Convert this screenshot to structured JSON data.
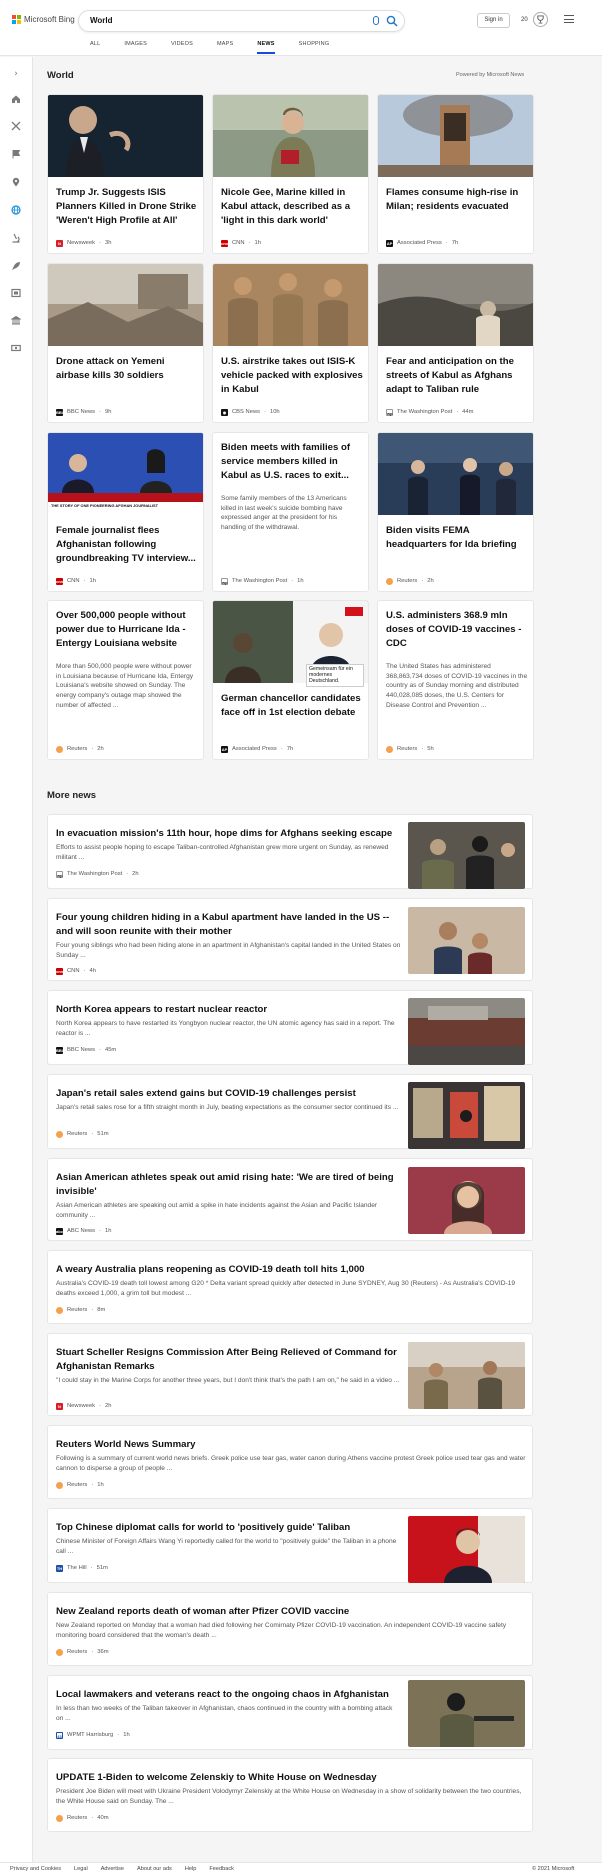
{
  "brand": "Microsoft Bing",
  "search": {
    "value": "World"
  },
  "header": {
    "sign_in": "Sign in",
    "rewards_count": "20"
  },
  "tabs": [
    "ALL",
    "IMAGES",
    "VIDEOS",
    "MAPS",
    "NEWS",
    "SHOPPING"
  ],
  "page": {
    "title": "World",
    "powered_by": "Powered by Microsoft News",
    "more_news_title": "More news"
  },
  "cards": [
    {
      "title": "Trump Jr. Suggests ISIS Planners Killed in Drone Strike 'Weren't High Profile at All'",
      "source": "Newsweek",
      "time": "3h"
    },
    {
      "title": "Nicole Gee, Marine killed in Kabul attack, described as a 'light in this dark world'",
      "source": "CNN",
      "time": "1h"
    },
    {
      "title": "Flames consume high-rise in Milan; residents evacuated",
      "source": "Associated Press",
      "time": "7h"
    },
    {
      "title": "Drone attack on Yemeni airbase kills 30 soldiers",
      "source": "BBC News",
      "time": "9h"
    },
    {
      "title": "U.S. airstrike takes out ISIS-K vehicle packed with explosives in Kabul",
      "source": "CBS News",
      "time": "10h"
    },
    {
      "title": "Fear and anticipation on the streets of Kabul as Afghans adapt to Taliban rule",
      "source": "The Washington Post",
      "time": "44m"
    },
    {
      "title": "Female journalist flees Afghanistan following groundbreaking TV interview...",
      "source": "CNN",
      "time": "1h",
      "img_caption": "THE STORY OF ONE PIONEERING AFGHAN JOURNALIST"
    },
    {
      "title": "Biden meets with families of service members killed in Kabul as U.S. races to exit...",
      "snippet": "Some family members of the 13 Americans killed in last week's suicide bombing have expressed anger at the president for his handling of the withdrawal.",
      "source": "The Washington Post",
      "time": "1h"
    },
    {
      "title": "Biden visits FEMA headquarters for Ida briefing",
      "source": "Reuters",
      "time": "2h"
    },
    {
      "title": "Over 500,000 people without power due to Hurricane Ida - Entergy Louisiana website",
      "snippet": "More than 500,000 people were without power in Louisiana because of Hurricane Ida, Entergy Louisiana's website showed on Sunday. The energy company's outage map showed the number of affected ...",
      "source": "Reuters",
      "time": "2h"
    },
    {
      "title": "German chancellor candidates face off in 1st election debate",
      "source": "Associated Press",
      "time": "7h",
      "img_caption": "Gemeinsam für ein modernes Deutschland."
    },
    {
      "title": "U.S. administers 368.9 mln doses of COVID-19 vaccines - CDC",
      "snippet": "The United States has administered 368,863,734 doses of COVID-19 vaccines in the country as of Sunday morning and distributed 440,028,085 doses, the U.S. Centers for Disease Control and Prevention ...",
      "source": "Reuters",
      "time": "5h"
    }
  ],
  "more_news": [
    {
      "title": "In evacuation mission's 11th hour, hope dims for Afghans seeking escape",
      "snippet": "Efforts to assist people hoping to escape Taliban-controlled Afghanistan grew more urgent on Sunday, as renewed militant ...",
      "source": "The Washington Post",
      "time": "2h"
    },
    {
      "title": "Four young children hiding in a Kabul apartment have landed in the US -- and will soon reunite with their mother",
      "snippet": "Four young siblings who had been hiding alone in an apartment in Afghanistan's capital landed in the United States on Sunday ...",
      "source": "CNN",
      "time": "4h"
    },
    {
      "title": "North Korea appears to restart nuclear reactor",
      "snippet": "North Korea appears to have restarted its Yongbyon nuclear reactor, the UN atomic agency has said in a report. The reactor is ...",
      "source": "BBC News",
      "time": "45m"
    },
    {
      "title": "Japan's retail sales extend gains but COVID-19 challenges persist",
      "snippet": "Japan's retail sales rose for a fifth straight month in July, beating expectations as the consumer sector continued its ...",
      "source": "Reuters",
      "time": "51m"
    },
    {
      "title": "Asian American athletes speak out amid rising hate: 'We are tired of being invisible'",
      "snippet": "Asian American athletes are speaking out amid a spike in hate incidents against the Asian and Pacific Islander community ...",
      "source": "ABC News",
      "time": "1h"
    },
    {
      "title": "A weary Australia plans reopening as COVID-19 death toll hits 1,000",
      "snippet": "Australia's COVID-19 death toll lowest among G20 * Delta variant spread quickly after detected in June SYDNEY, Aug 30 (Reuters) - As Australia's COVID-19 deaths exceed 1,000, a grim toll but modest ...",
      "source": "Reuters",
      "time": "8m"
    },
    {
      "title": "Stuart Scheller Resigns Commission After Being Relieved of Command for Afghanistan Remarks",
      "snippet": "\"I could stay in the Marine Corps for another three years, but I don't think that's the path I am on,\" he said in a video ...",
      "source": "Newsweek",
      "time": "2h"
    },
    {
      "title": "Reuters World News Summary",
      "snippet": "Following is a summary of current world news briefs. Greek police use tear gas, water canon during Athens vaccine protest Greek police used tear gas and water cannon to disperse a group of people ...",
      "source": "Reuters",
      "time": "1h"
    },
    {
      "title": "Top Chinese diplomat calls for world to 'positively guide' Taliban",
      "snippet": "Chinese Minister of Foreign Affairs Wang Yi reportedly called for the world to \"positively guide\" the Taliban in a phone call ...",
      "source": "The Hill",
      "time": "51m"
    },
    {
      "title": "New Zealand reports death of woman after Pfizer COVID vaccine",
      "snippet": "New Zealand reported on Monday that a woman had died following her Comirnaty Pfizer COVID-19 vaccination. An independent COVID-19 vaccine safety monitoring board considered that the woman's death ...",
      "source": "Reuters",
      "time": "36m"
    },
    {
      "title": "Local lawmakers and veterans react to the ongoing chaos in Afghanistan",
      "snippet": "In less than two weeks of the Taliban takeover in Afghanistan, chaos continued in the country with a bombing attack on ...",
      "source": "WPMT Harrisburg",
      "time": "1h"
    },
    {
      "title": "UPDATE 1-Biden to welcome Zelenskiy to White House on Wednesday",
      "snippet": "President Joe Biden will meet with Ukraine President Volodymyr Zelenskiy at the White House on Wednesday in a show of solidarity between the two countries, the White House said on Sunday. The ...",
      "source": "Reuters",
      "time": "40m"
    }
  ],
  "footer": {
    "links": [
      "Privacy and Cookies",
      "Legal",
      "Advertise",
      "About our ads",
      "Help",
      "Feedback"
    ],
    "copyright": "© 2021 Microsoft"
  },
  "icons": {
    "rail": [
      "expand-icon",
      "home-icon",
      "crossed-arrows-icon",
      "flag-icon",
      "location-pin-icon",
      "globe-icon",
      "microscope-icon",
      "rocket-icon",
      "film-icon",
      "building-icon",
      "money-icon"
    ],
    "header": [
      "microphone-icon",
      "search-icon",
      "rewards-trophy-icon",
      "hamburger-menu-icon"
    ]
  },
  "colors": {
    "accent": "#174ae4",
    "search_icon": "#1f75c9",
    "rail_icon": "#7a7a7a",
    "active_rail_icon": "#1f8fd6"
  }
}
